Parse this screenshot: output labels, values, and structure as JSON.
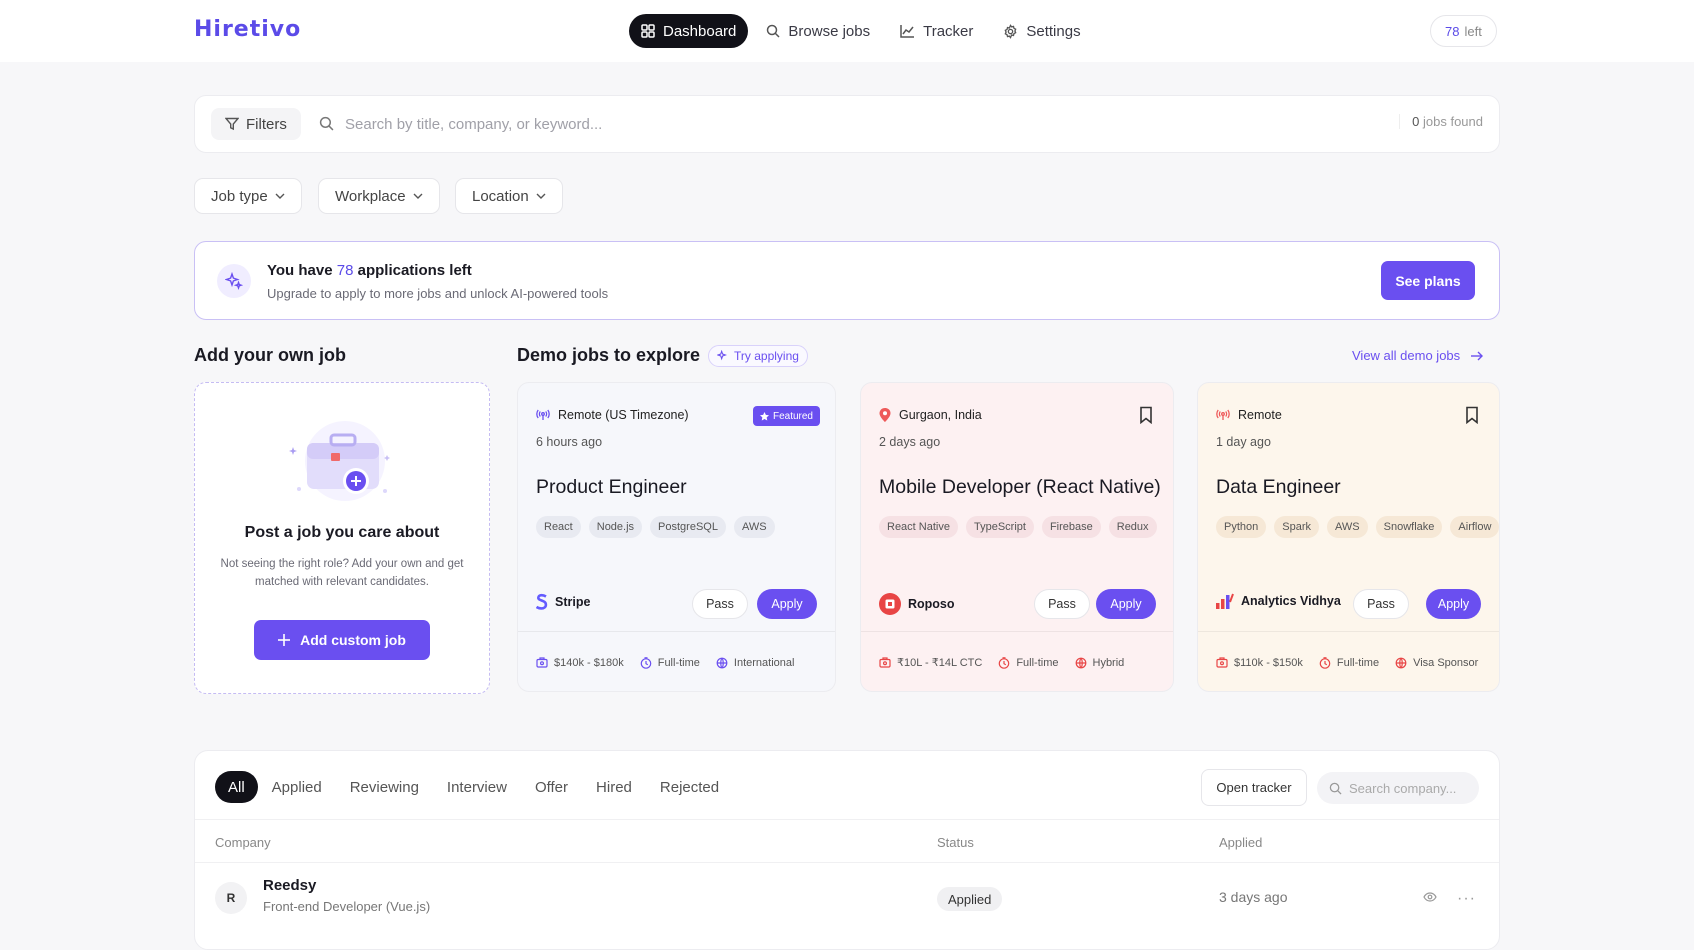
{
  "brand": {
    "logo": "Hiretivo",
    "accent": "#6a4ff0"
  },
  "nav": {
    "items": [
      {
        "label": "Dashboard",
        "icon": "grid-icon",
        "active": true
      },
      {
        "label": "Browse jobs",
        "icon": "search-icon"
      },
      {
        "label": "Tracker",
        "icon": "chart-line-icon"
      },
      {
        "label": "Settings",
        "icon": "gear-icon"
      }
    ]
  },
  "credits": {
    "count": "78",
    "label": "left"
  },
  "search": {
    "filters_label": "Filters",
    "placeholder": "Search by title, company, or keyword...",
    "count": "0",
    "count_label": "jobs found"
  },
  "dropdowns": [
    {
      "label": "Job type"
    },
    {
      "label": "Workplace"
    },
    {
      "label": "Location"
    }
  ],
  "banner": {
    "prefix": "You have",
    "count": "78",
    "suffix": "applications left",
    "subtitle": "Upgrade to apply to more jobs and unlock AI-powered tools",
    "cta": "See plans"
  },
  "own_job": {
    "section_title": "Add your own job",
    "title": "Post a job you care about",
    "subtitle": "Not seeing the right role? Add your own and get matched with relevant candidates.",
    "button": "Add custom job"
  },
  "demo": {
    "section_title": "Demo jobs to explore",
    "pill": "Try applying",
    "view_all": "View all demo jobs",
    "jobs": [
      {
        "location": "Remote (US Timezone)",
        "location_icon": "remote-signal-icon",
        "ago": "6 hours ago",
        "title": "Product Engineer",
        "tags": [
          "React",
          "Node.js",
          "PostgreSQL",
          "AWS"
        ],
        "company": "Stripe",
        "pass": "Pass",
        "apply": "Apply",
        "salary": "$140k - $180k",
        "type": "Full-time",
        "extra": "International",
        "featured": "Featured",
        "bg": "#f6f7fb",
        "tag_bg": "#e8eaf1"
      },
      {
        "location": "Gurgaon, India",
        "location_icon": "map-pin-icon",
        "ago": "2 days ago",
        "title": "Mobile Developer (React Native)",
        "tags": [
          "React Native",
          "TypeScript",
          "Firebase",
          "Redux"
        ],
        "company": "Roposo",
        "pass": "Pass",
        "apply": "Apply",
        "salary": "₹10L - ₹14L CTC",
        "type": "Full-time",
        "extra": "Hybrid",
        "bg": "#fdf1f2",
        "tag_bg": "#f6e1e4"
      },
      {
        "location": "Remote",
        "location_icon": "remote-signal-icon",
        "ago": "1 day ago",
        "title": "Data Engineer",
        "tags": [
          "Python",
          "Spark",
          "AWS",
          "Snowflake",
          "Airflow"
        ],
        "company": "Analytics Vidhya",
        "pass": "Pass",
        "apply": "Apply",
        "salary": "$110k - $150k",
        "type": "Full-time",
        "extra": "Visa Sponsor",
        "bg": "#fdf6ec",
        "tag_bg": "#f6e8d6"
      }
    ]
  },
  "tracker": {
    "tabs": [
      "All",
      "Applied",
      "Reviewing",
      "Interview",
      "Offer",
      "Hired",
      "Rejected"
    ],
    "open_button": "Open tracker",
    "search_placeholder": "Search company...",
    "columns": {
      "company": "Company",
      "status": "Status",
      "applied": "Applied"
    },
    "rows": [
      {
        "initial": "R",
        "company": "Reedsy",
        "role": "Front-end Developer (Vue.js)",
        "status": "Applied",
        "applied": "3 days ago"
      }
    ]
  }
}
